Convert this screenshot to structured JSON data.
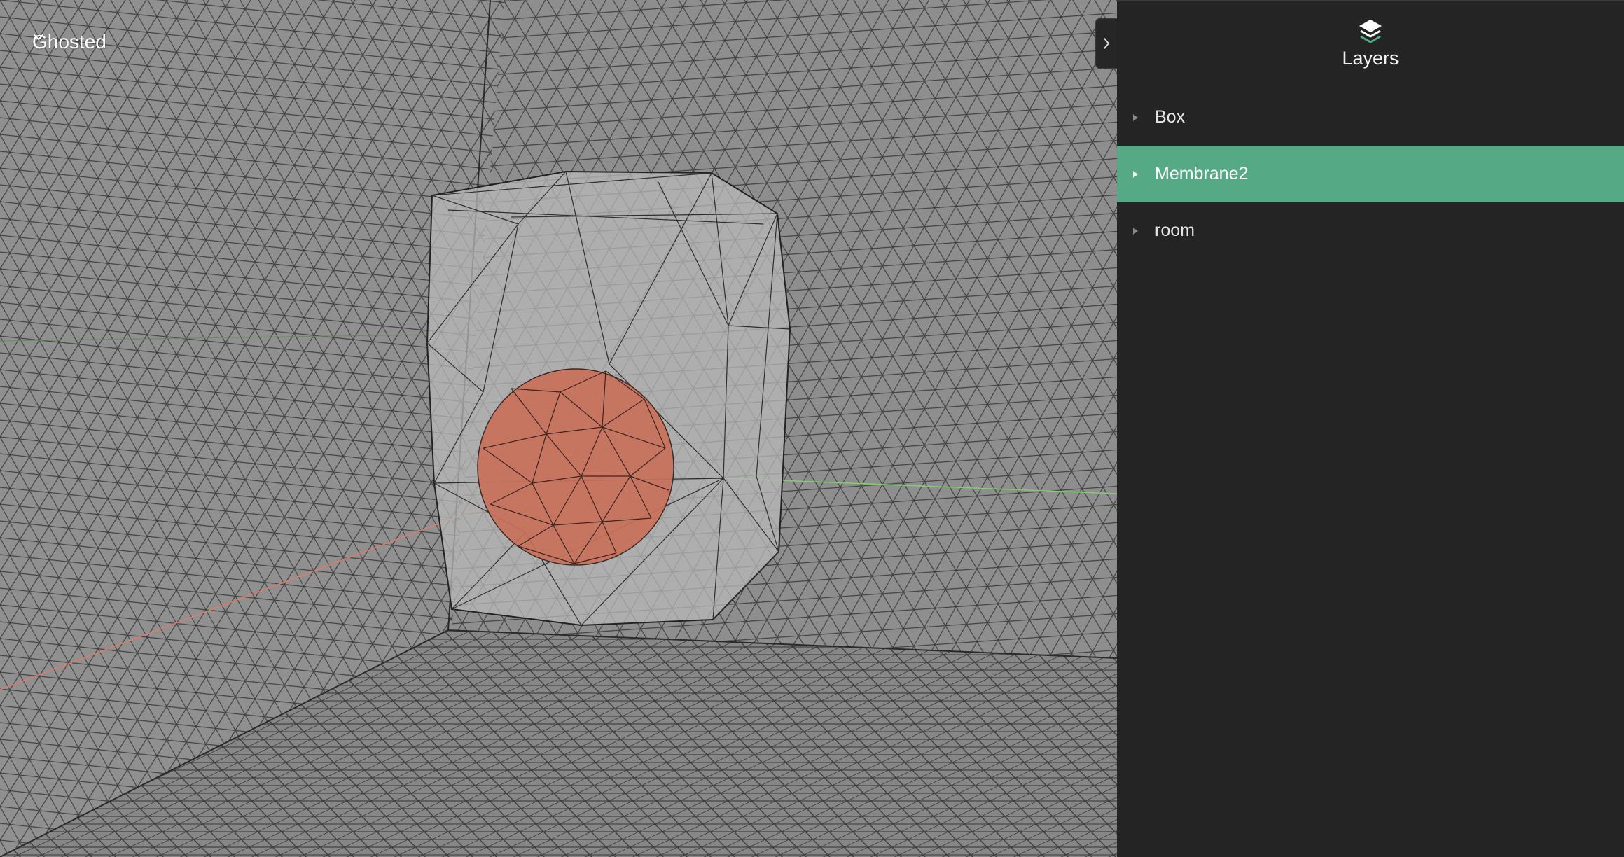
{
  "viewport": {
    "view_mode": "Ghosted",
    "colors": {
      "background": "#8c8c8c",
      "mesh_line": "#2e2e2e",
      "box_fill": "#b4b4b4",
      "sphere_fill": "#c8705a",
      "axis_x": "#e07a6a",
      "axis_y": "#7fd06a"
    },
    "icons": {
      "view_mode_dropdown": "chevron-down-icon"
    }
  },
  "panel_toggle": {
    "icon": "chevron-right-icon"
  },
  "sidebar": {
    "title": "Layers",
    "icon": "layers-icon",
    "accent": "#55a985",
    "layers": [
      {
        "label": "Box",
        "selected": false,
        "icon": "caret-right-icon"
      },
      {
        "label": "Membrane2",
        "selected": true,
        "icon": "caret-right-icon"
      },
      {
        "label": "room",
        "selected": false,
        "icon": "caret-right-icon"
      }
    ]
  }
}
